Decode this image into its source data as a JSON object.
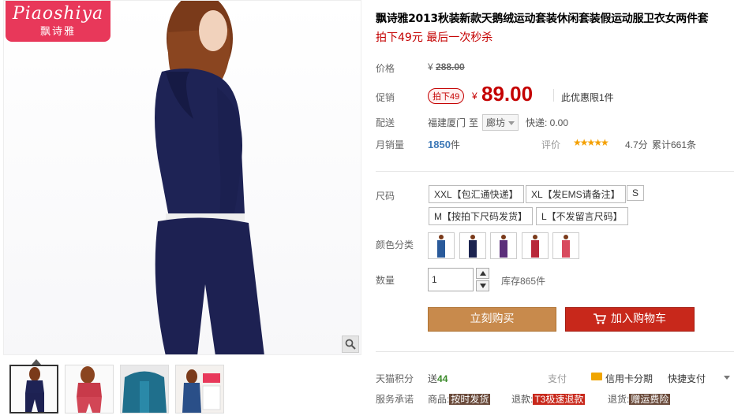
{
  "gallery": {
    "logo_script": "Piaoshiya",
    "logo_cn": "飘诗雅",
    "zoom_icon": "magnifier-icon",
    "thumbnails": [
      {
        "label": "navy-tracksuit-back"
      },
      {
        "label": "red-tracksuit-front"
      },
      {
        "label": "teal-hoodie-front"
      },
      {
        "label": "blue-tracksuit-promo"
      }
    ]
  },
  "product": {
    "title": "飘诗雅2013秋装新款天鹅绒运动套装休闲套装假运动服卫衣女两件套",
    "subtitle": "拍下49元 最后一次秒杀"
  },
  "price": {
    "label": "价格",
    "currency": "¥",
    "original": "288.00"
  },
  "promo": {
    "label": "促销",
    "tag": "拍下49",
    "currency": "¥",
    "price": "89.00",
    "limit": "此优惠限1件"
  },
  "shipping": {
    "label": "配送",
    "from": "福建厦门",
    "to_word": "至",
    "city": "廊坊",
    "fee": "快递: 0.00"
  },
  "sales": {
    "label": "月销量",
    "count": "1850",
    "unit": "件",
    "rating_label": "评价",
    "stars": "★★★★★",
    "rating_value": 4.7,
    "score_text": "4.7分",
    "total": "累计661条"
  },
  "sizes": {
    "label": "尺码",
    "options": [
      "XXL【包汇通快递】",
      "XL【发EMS请备注】",
      "S",
      "M【按拍下尺码发货】",
      "L【不发留言尺码】"
    ]
  },
  "colors": {
    "label": "颜色分类",
    "swatches": [
      {
        "name": "blue-swatch",
        "color": "#2a5a9a"
      },
      {
        "name": "navy-swatch",
        "color": "#1c2450"
      },
      {
        "name": "purple-swatch",
        "color": "#5b2f7a"
      },
      {
        "name": "red-swatch",
        "color": "#b8283a"
      },
      {
        "name": "pink-swatch",
        "color": "#d84a5e"
      }
    ]
  },
  "quantity": {
    "label": "数量",
    "value": "1",
    "stock": "库存865件"
  },
  "actions": {
    "buy_label": "立刻购买",
    "cart_label": "加入购物车"
  },
  "footer": {
    "points_label": "天猫积分",
    "points_prefix": "送",
    "points_value": "44",
    "pay_label": "支付",
    "credit_label": "信用卡分期",
    "quickpay_label": "快捷支付",
    "service_label": "服务承诺",
    "goods_label": "商品:",
    "goods_badge": "按时发货",
    "refund_label": "退款:",
    "refund_badge": "T3极速退款",
    "return_label": "退货:",
    "return_badge": "赠运费险"
  }
}
